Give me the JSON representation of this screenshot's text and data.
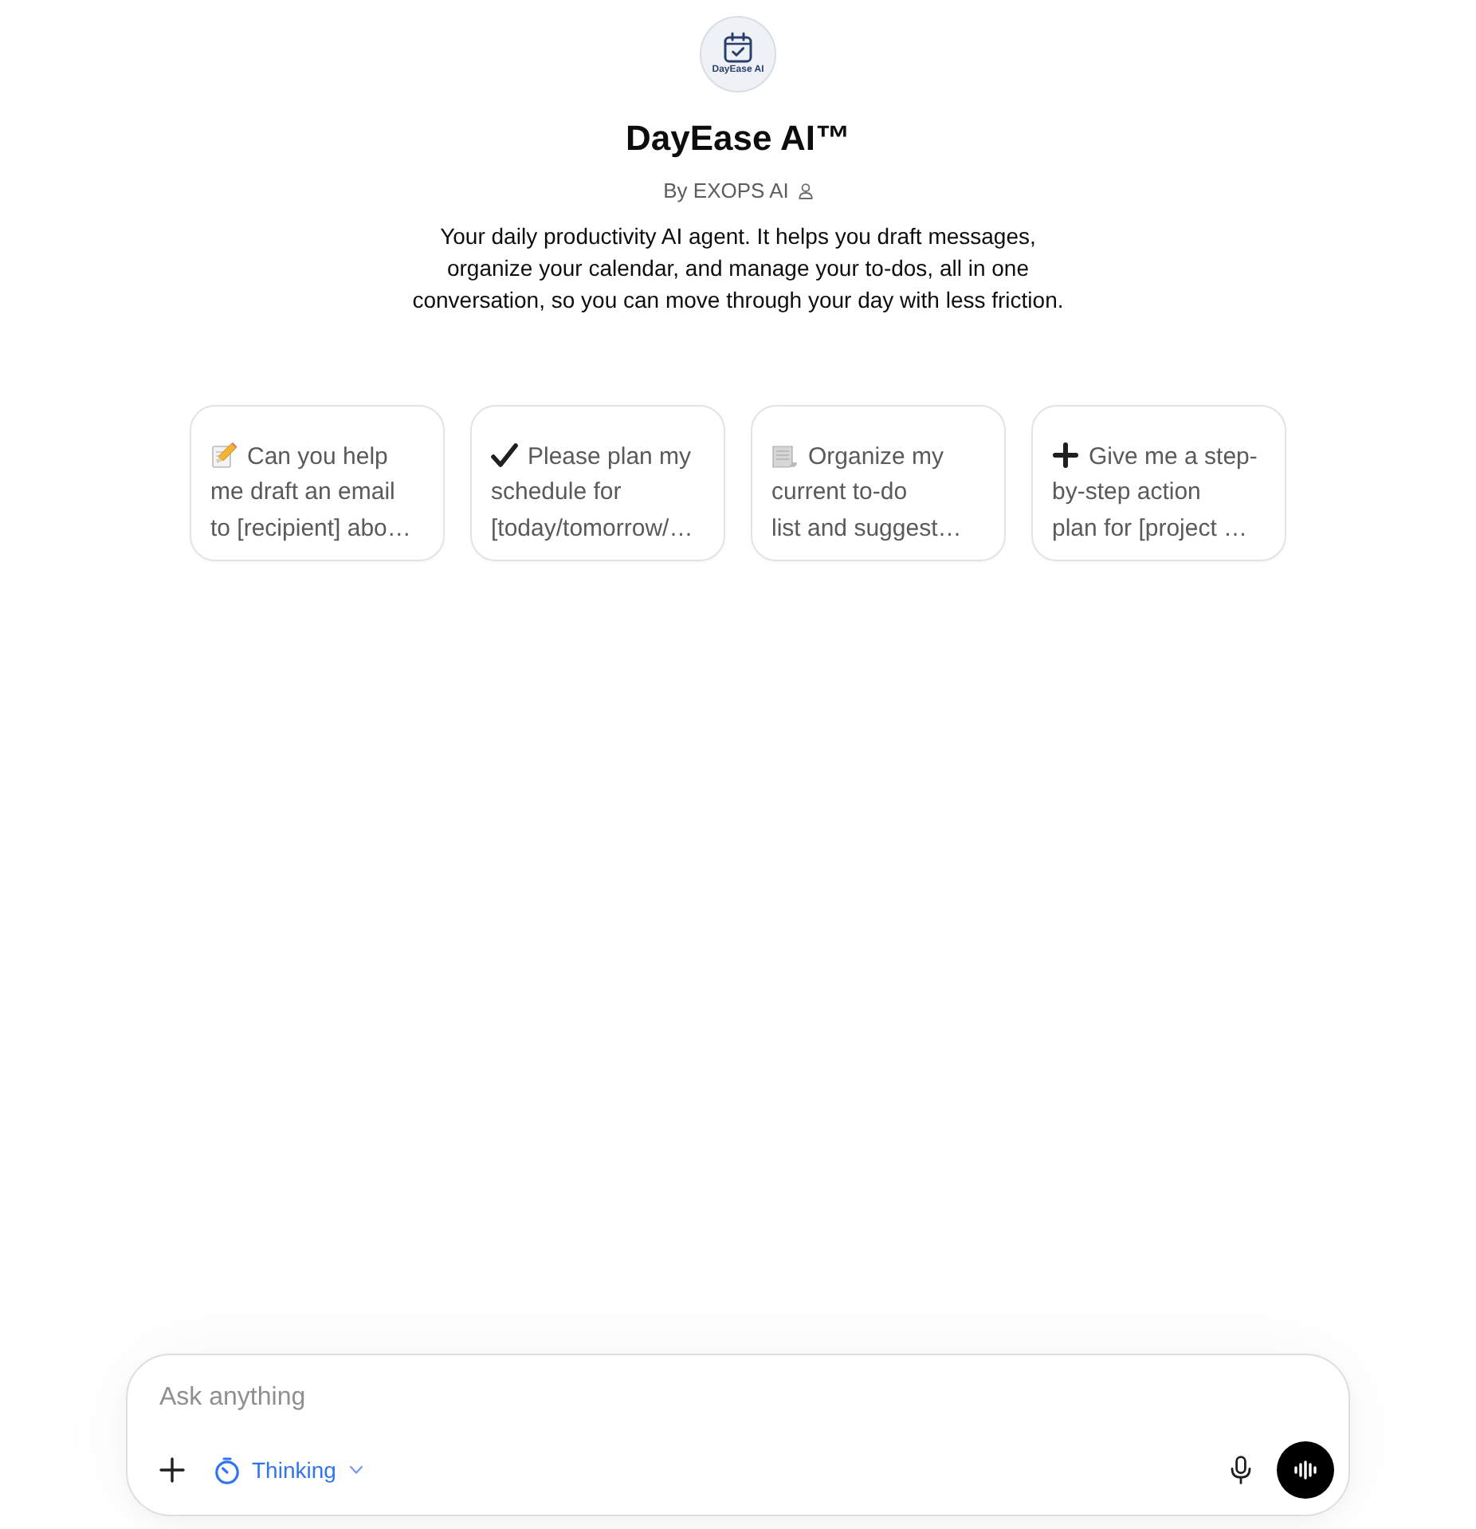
{
  "agent": {
    "logo_text": "DayEase AI",
    "name": "DayEase AI™",
    "author": "By EXOPS AI",
    "description": "Your daily productivity AI agent. It helps you draft messages, organize your calendar, and manage your to-dos, all in one conversation, so you can move through your day with less friction."
  },
  "suggestions": [
    {
      "kind": "memo",
      "text": "Can you help\nme draft an email\nto [recipient] abo…"
    },
    {
      "kind": "check",
      "text": "Please plan my\nschedule for\n[today/tomorrow/…"
    },
    {
      "kind": "page",
      "text": "Organize my\ncurrent to-do\nlist and suggest…"
    },
    {
      "kind": "plus",
      "text": "Give me a step-\nby-step action\nplan for [project …"
    }
  ],
  "composer": {
    "placeholder": "Ask anything",
    "mode": "Thinking"
  }
}
